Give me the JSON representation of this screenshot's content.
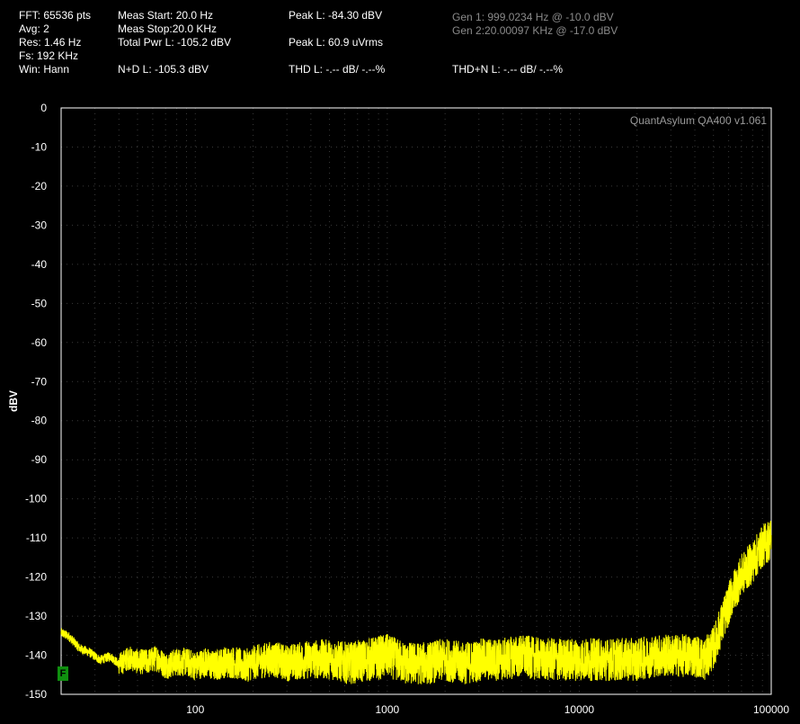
{
  "header": {
    "fft": "FFT: 65536 pts",
    "avg": "Avg: 2",
    "res": "Res: 1.46 Hz",
    "fs": "Fs: 192 KHz",
    "win": "Win: Hann",
    "meas_start": "Meas Start: 20.0 Hz",
    "meas_stop": "Meas Stop:20.0 KHz",
    "total_pwr": "Total Pwr L: -105.2 dBV",
    "nd": "N+D L: -105.3 dBV",
    "peak_dbv": "Peak L: -84.30 dBV",
    "peak_vrms": "Peak L: 60.9 uVrms",
    "thd": "THD L: -.-- dB/ -.--%",
    "gen1": "Gen 1: 999.0234 Hz @ -10.0  dBV",
    "gen2": "Gen 2:20.00097 KHz @ -17.0  dBV",
    "thdn": "THD+N L: -.-- dB/ -.--%"
  },
  "watermark": "QuantAsylum QA400 v1.061",
  "flag_label": "F",
  "colors": {
    "trace": "#ffff00",
    "grid": "#3a3a3a",
    "background": "#000000",
    "flag": "#0f8f0f"
  },
  "chart_data": {
    "type": "line",
    "title": "",
    "xlabel": "",
    "ylabel": "dBV",
    "xscale": "log",
    "xlim": [
      20,
      100000
    ],
    "ylim": [
      -150,
      0
    ],
    "xticks": [
      "100",
      "1000",
      "10000",
      "100000"
    ],
    "yticks": [
      "0",
      "-10",
      "-20",
      "-30",
      "-40",
      "-50",
      "-60",
      "-70",
      "-80",
      "-90",
      "-100",
      "-110",
      "-120",
      "-130",
      "-140",
      "-150"
    ],
    "grid": true,
    "series": [
      {
        "x": [
          20,
          22,
          25,
          28,
          32,
          36,
          40,
          45,
          50,
          56,
          63,
          70,
          80,
          90,
          100,
          112,
          125,
          140,
          160,
          180,
          200,
          250,
          300,
          400,
          500,
          630,
          800,
          1000,
          1250,
          1600,
          2000,
          2500,
          3150,
          4000,
          5000,
          6300,
          8000,
          10000,
          12500,
          16000,
          20000,
          25000,
          31500,
          40000,
          45000,
          50000,
          56000,
          63000,
          71000,
          80000,
          90000,
          100000
        ],
        "y": [
          -134,
          -135,
          -138,
          -139,
          -141,
          -140,
          -142,
          -140,
          -141,
          -141,
          -140,
          -142,
          -141,
          -141,
          -142,
          -141,
          -142,
          -141,
          -141,
          -142,
          -141,
          -140,
          -141,
          -140,
          -140,
          -141,
          -140,
          -139,
          -141,
          -141,
          -140,
          -141,
          -140,
          -140,
          -139,
          -140,
          -140,
          -140,
          -140,
          -140,
          -140,
          -139,
          -139,
          -139,
          -140,
          -137,
          -130,
          -123,
          -118,
          -115,
          -111,
          -109
        ]
      }
    ]
  }
}
